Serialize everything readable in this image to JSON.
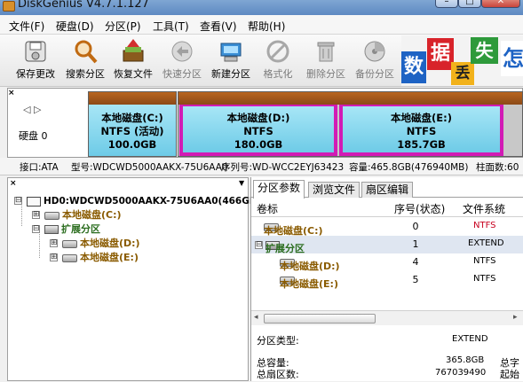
{
  "title": "DiskGenius V4.7.1.127",
  "window_controls": {
    "minimize": "–",
    "maximize": "□",
    "close": "✕"
  },
  "menu": [
    "文件(F)",
    "硬盘(D)",
    "分区(P)",
    "工具(T)",
    "查看(V)",
    "帮助(H)"
  ],
  "toolbar": [
    {
      "label": "保存更改",
      "icon": "save-icon"
    },
    {
      "label": "搜索分区",
      "icon": "search-partition-icon"
    },
    {
      "label": "恢复文件",
      "icon": "recover-files-icon"
    },
    {
      "label": "快速分区",
      "icon": "quick-partition-icon"
    },
    {
      "label": "新建分区",
      "icon": "new-partition-icon"
    },
    {
      "label": "格式化",
      "icon": "format-icon"
    },
    {
      "label": "删除分区",
      "icon": "delete-partition-icon"
    },
    {
      "label": "备份分区",
      "icon": "backup-partition-icon"
    }
  ],
  "banner": {
    "chars": [
      "数",
      "据",
      "丢",
      "失",
      "怎"
    ]
  },
  "disk_panel": {
    "close_mark": "×",
    "nav": "◁ ▷",
    "disk_label": "硬盘 0",
    "partitions": [
      {
        "name": "本地磁盘(C:)",
        "fs": "NTFS (活动)",
        "size": "100.0GB"
      },
      {
        "name": "本地磁盘(D:)",
        "fs": "NTFS",
        "size": "180.0GB"
      },
      {
        "name": "本地磁盘(E:)",
        "fs": "NTFS",
        "size": "185.7GB"
      }
    ]
  },
  "info_bar": {
    "interface": "接口:ATA",
    "model": "型号:WDCWD5000AAKX-75U6AA0",
    "serial": "序列号:WD-WCC2EYJ63423",
    "capacity": "容量:465.8GB(476940MB)",
    "cylinders": "柱面数:60"
  },
  "left_pane": {
    "close_mark": "×",
    "pin_mark": "▼",
    "tree": [
      {
        "label": "HD0:WDCWD5000AAKX-75U6AA0(466GB)",
        "expander": "⊟"
      },
      {
        "label": "本地磁盘(C:)",
        "expander": "⊞"
      },
      {
        "label": "扩展分区",
        "expander": "⊟"
      },
      {
        "label": "本地磁盘(D:)",
        "expander": "⊞"
      },
      {
        "label": "本地磁盘(E:)",
        "expander": "⊞"
      }
    ]
  },
  "right_pane": {
    "tabs": [
      "分区参数",
      "浏览文件",
      "扇区编辑"
    ],
    "columns": [
      "卷标",
      "序号(状态)",
      "文件系统"
    ],
    "rows": [
      {
        "label": "本地磁盘(C:)",
        "index": "0",
        "fs": "NTFS"
      },
      {
        "label": "扩展分区",
        "index": "1",
        "fs": "EXTEND",
        "expander": "⊟"
      },
      {
        "label": "本地磁盘(D:)",
        "index": "4",
        "fs": "NTFS"
      },
      {
        "label": "本地磁盘(E:)",
        "index": "5",
        "fs": "NTFS"
      }
    ],
    "scroll": {
      "left": "◂",
      "right": "▸"
    },
    "properties": {
      "type_label": "分区类型:",
      "type_value": "EXTEND",
      "total_capacity_label": "总容量:",
      "total_capacity_value": "365.8GB",
      "total_sectors_label": "总扇区数:",
      "total_sectors_value": "767039490",
      "right_col_1": "总字",
      "right_col_2": "起始"
    }
  },
  "colors": {
    "partition_header": "#8c4a17",
    "partition_body": "#6ecbe7",
    "selection_border": "#d21bb5",
    "volume_label": "#8a5b00",
    "ntfs_red": "#c7001f"
  }
}
